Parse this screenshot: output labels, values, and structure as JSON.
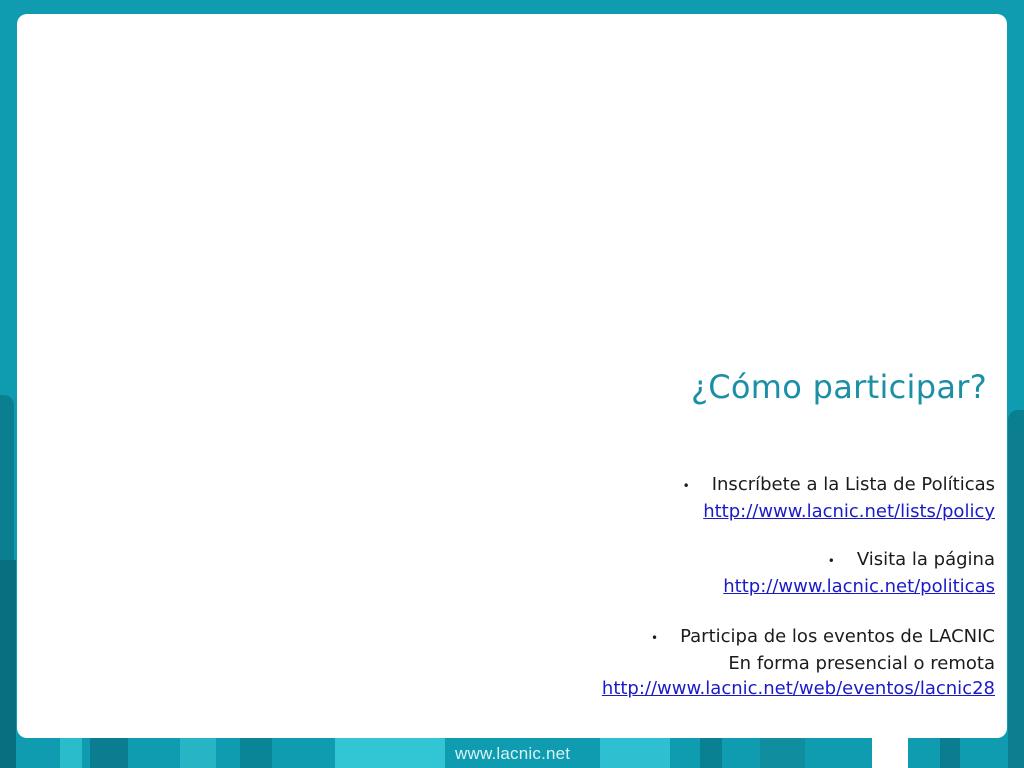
{
  "slide": {
    "title": "¿Cómo participar?",
    "bullets": [
      {
        "bullet_char": "•",
        "text": "Inscríbete a la Lista de Políticas",
        "link": "http://www.lacnic.net/lists/policy"
      },
      {
        "bullet_char": "•",
        "text": "Visita la página",
        "link": "http://www.lacnic.net/politicas"
      },
      {
        "bullet_char": "•",
        "text": "Participa de los eventos de LACNIC",
        "subtext": "En forma presencial o remota",
        "link": "http://www.lacnic.net/web/eventos/lacnic28"
      }
    ]
  },
  "footer": {
    "url": "www.lacnic.net"
  },
  "colors": {
    "background": "#0f9cb0",
    "title": "#1a8fa5",
    "link": "#1a1ac8"
  }
}
